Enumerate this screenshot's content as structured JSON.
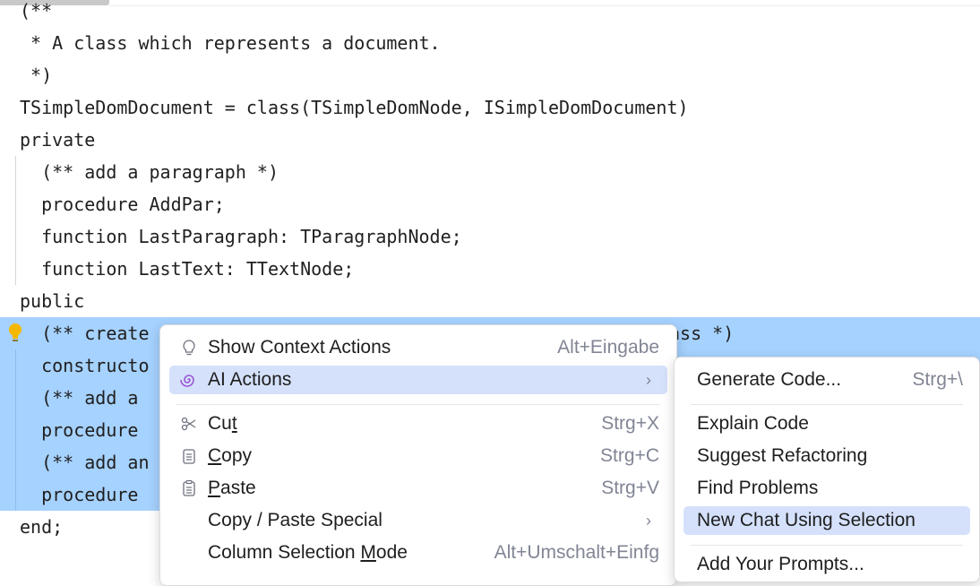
{
  "editor": {
    "lines": [
      "(**",
      " * A class which represents a document.",
      " *)",
      "TSimpleDomDocument = class(TSimpleDomNode, ISimpleDomDocument)",
      "private",
      "  (** add a paragraph *)",
      "  procedure AddPar;",
      "  function LastParagraph: TParagraphNode;",
      "  function LastText: TTextNode;",
      "public",
      "  (** create",
      "  constructo",
      "  (** add a",
      "  procedure",
      "  (** add an",
      "  procedure",
      "end;"
    ],
    "line10_tail": "ass *)"
  },
  "context_menu": {
    "items": [
      {
        "label": "Show Context Actions",
        "shortcut": "Alt+Eingabe",
        "icon": "lightbulb-icon"
      },
      {
        "label": "AI Actions",
        "shortcut": "",
        "icon": "ai-spiral-icon",
        "submenu": true
      },
      {
        "label_pre": "Cu",
        "label_u": "t",
        "label_post": "",
        "shortcut": "Strg+X",
        "icon": "scissors-icon"
      },
      {
        "label_pre": "",
        "label_u": "C",
        "label_post": "opy",
        "shortcut": "Strg+C",
        "icon": "copy-icon"
      },
      {
        "label_pre": "",
        "label_u": "P",
        "label_post": "aste",
        "shortcut": "Strg+V",
        "icon": "paste-icon"
      },
      {
        "label": "Copy / Paste Special",
        "shortcut": "",
        "submenu": true
      },
      {
        "label_pre": "Column Selection ",
        "label_u": "M",
        "label_post": "ode",
        "shortcut": "Alt+Umschalt+Einfg"
      }
    ]
  },
  "ai_submenu": {
    "items": [
      {
        "label": "Generate Code...",
        "shortcut": "Strg+\\"
      },
      {
        "label": "Explain Code"
      },
      {
        "label": "Suggest Refactoring"
      },
      {
        "label": "Find Problems"
      },
      {
        "label": "New Chat Using Selection"
      },
      {
        "label": "Add Your Prompts..."
      }
    ]
  }
}
